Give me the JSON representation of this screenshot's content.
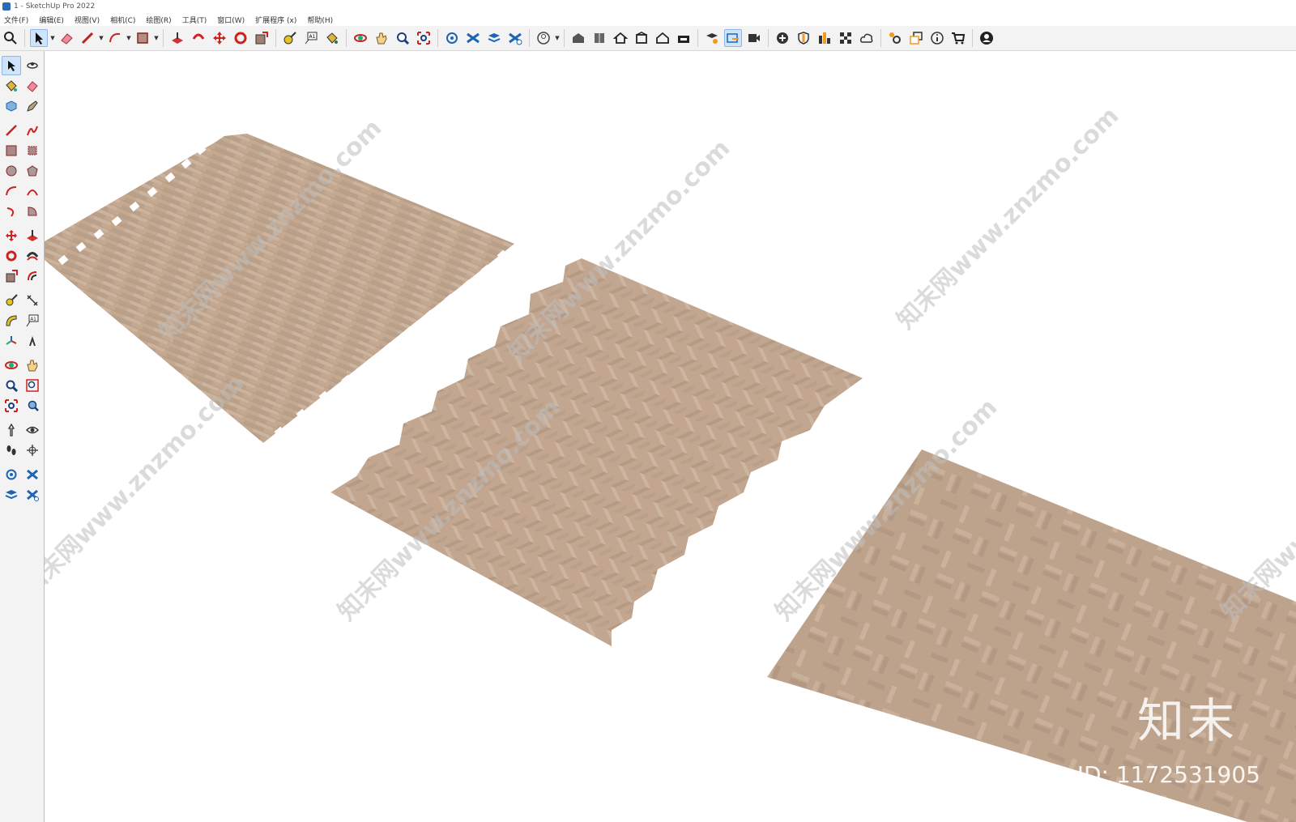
{
  "window": {
    "title": "1 - SketchUp Pro 2022"
  },
  "menu": [
    "文件(F)",
    "编辑(E)",
    "视图(V)",
    "相机(C)",
    "绘图(R)",
    "工具(T)",
    "窗口(W)",
    "扩展程序 (x)",
    "帮助(H)"
  ],
  "toolbar_icons": [
    "search",
    "select",
    "eraser",
    "pencil",
    "arc",
    "rectangle",
    "push-pull",
    "follow-me",
    "move",
    "rotate",
    "scale",
    "tape-measure",
    "text",
    "paint",
    "orbit",
    "pan",
    "zoom",
    "zoom-extents",
    "section-plane",
    "styles",
    "layers",
    "tags",
    "user",
    "warehouse-3d",
    "component",
    "house",
    "model-info",
    "home",
    "outline",
    "warehouse",
    "send-to-layout",
    "section-fill",
    "plus",
    "shield",
    "chart",
    "checker",
    "cloud",
    "gear",
    "copy",
    "info",
    "cart",
    "account"
  ],
  "sidebar_icons": [
    "select",
    "orbit",
    "paint-bucket",
    "eraser",
    "component",
    "tag",
    "pencil",
    "freehand",
    "rectangle",
    "rotated-rectangle",
    "circle",
    "polygon",
    "arc",
    "pie",
    "arc-3pt",
    "two-point-arc",
    "move",
    "push-pull",
    "rotate",
    "follow-me",
    "scale",
    "offset",
    "tape-measure",
    "dimension",
    "protractor",
    "text",
    "axes",
    "3d-text",
    "orbit-tool",
    "pan-tool",
    "zoom",
    "zoom-window",
    "zoom-extents",
    "previous-view",
    "position-camera",
    "look-around",
    "walk",
    "section",
    "styles-panel",
    "layers-panel",
    "tags-panel",
    "scenes-panel"
  ],
  "watermark": {
    "text": "知末网www.znzmo.com",
    "logo": "知末",
    "id": "ID: 1172531905"
  },
  "colors": {
    "wood": "#c4a88f",
    "wood_dark": "#b59880",
    "toolbar_bg": "#f3f3f3",
    "active": "#cfe3fb"
  }
}
